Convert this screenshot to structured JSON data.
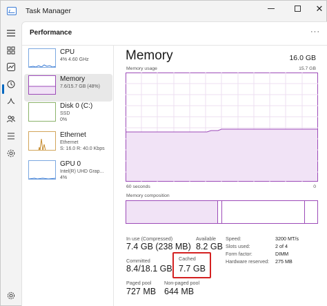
{
  "window": {
    "title": "Task Manager"
  },
  "header": {
    "title": "Performance",
    "more": "···"
  },
  "rail": {
    "icons": [
      "hamburger-icon",
      "processes-icon",
      "performance-icon",
      "app-history-icon",
      "startup-apps-icon",
      "users-icon",
      "details-icon",
      "services-icon",
      "settings-icon"
    ]
  },
  "sidebar": {
    "items": [
      {
        "name": "CPU",
        "sub1": "4%  4.60 GHz",
        "sub2": ""
      },
      {
        "name": "Memory",
        "sub1": "7.6/15.7 GB (48%)",
        "sub2": ""
      },
      {
        "name": "Disk 0 (C:)",
        "sub1": "SSD",
        "sub2": "0%"
      },
      {
        "name": "Ethernet",
        "sub1": "Ethernet",
        "sub2": "S: 16.0  R: 40.0 Kbps"
      },
      {
        "name": "GPU 0",
        "sub1": "Intel(R) UHD Grap...",
        "sub2": "4%"
      }
    ]
  },
  "memory": {
    "title": "Memory",
    "total": "16.0 GB",
    "usage_label": "Memory usage",
    "usage_max": "15.7 GB",
    "time_label": "60 seconds",
    "time_right": "0",
    "composition_label": "Memory composition",
    "in_use_fraction": 0.48,
    "stats": {
      "in_use_label": "In use (Compressed)",
      "in_use_value": "7.4 GB (238 MB)",
      "available_label": "Available",
      "available_value": "8.2 GB",
      "committed_label": "Committed",
      "committed_value": "8.4/18.1 GB",
      "cached_label": "Cached",
      "cached_value": "7.7 GB",
      "paged_label": "Paged pool",
      "paged_value": "727 MB",
      "nonpaged_label": "Non-paged pool",
      "nonpaged_value": "644 MB"
    },
    "details": [
      {
        "label": "Speed:",
        "value": "3200 MT/s"
      },
      {
        "label": "Slots used:",
        "value": "2 of 4"
      },
      {
        "label": "Form factor:",
        "value": "DIMM"
      },
      {
        "label": "Hardware reserved:",
        "value": "275 MB"
      }
    ]
  },
  "colors": {
    "memory": "#9c4ab8",
    "cpu": "#3a7bd5",
    "ethernet": "#c58a2c",
    "highlight": "#d42020"
  }
}
